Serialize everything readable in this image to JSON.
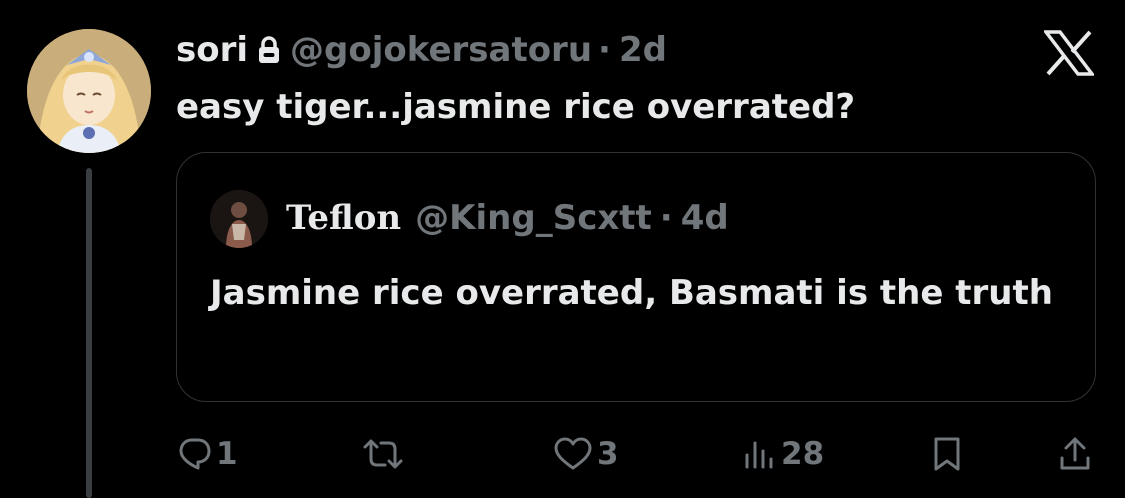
{
  "tweet": {
    "author_name": "sori",
    "handle": "@gojokersatoru",
    "separator": "·",
    "age": "2d",
    "text": "easy tiger...jasmine rice overrated?",
    "avatar_icon": "anime-character-avatar",
    "protected_icon": "lock-icon"
  },
  "quoted_tweet": {
    "author_name": "Teflon",
    "handle": "@King_Scxtt",
    "separator": "·",
    "age": "4d",
    "text": "Jasmine rice overrated, Basmati is the truth"
  },
  "actions": {
    "replies": "1",
    "retweets": "",
    "likes": "3",
    "views": "28"
  },
  "brand": {
    "logo": "x-logo"
  },
  "colors": {
    "background": "#000000",
    "text_primary": "#e7e9ea",
    "text_secondary": "#71767b",
    "border": "#2f3336"
  }
}
